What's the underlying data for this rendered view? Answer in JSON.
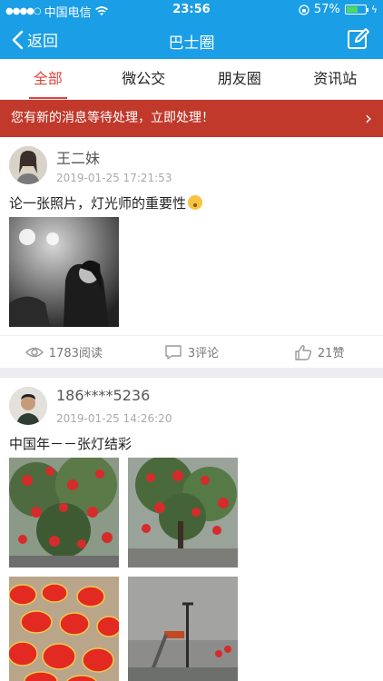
{
  "status": {
    "carrier": "中国电信",
    "time": "23:56",
    "battery": "57%"
  },
  "nav": {
    "back_label": "返回",
    "title": "巴士圈"
  },
  "tabs": [
    {
      "label": "全部"
    },
    {
      "label": "微公交"
    },
    {
      "label": "朋友圈"
    },
    {
      "label": "资讯站"
    }
  ],
  "banner": {
    "text": "您有新的消息等待处理，立即处理！"
  },
  "posts": [
    {
      "user": "王二妹",
      "time": "2019-01-25 17:21:53",
      "text": "论一张照片，灯光师的重要性",
      "reads": "1783阅读",
      "comments": "3评论",
      "likes": "21赞"
    },
    {
      "user": "186****5236",
      "time": "2019-01-25 14:26:20",
      "text": "中国年－－张灯结彩"
    }
  ]
}
